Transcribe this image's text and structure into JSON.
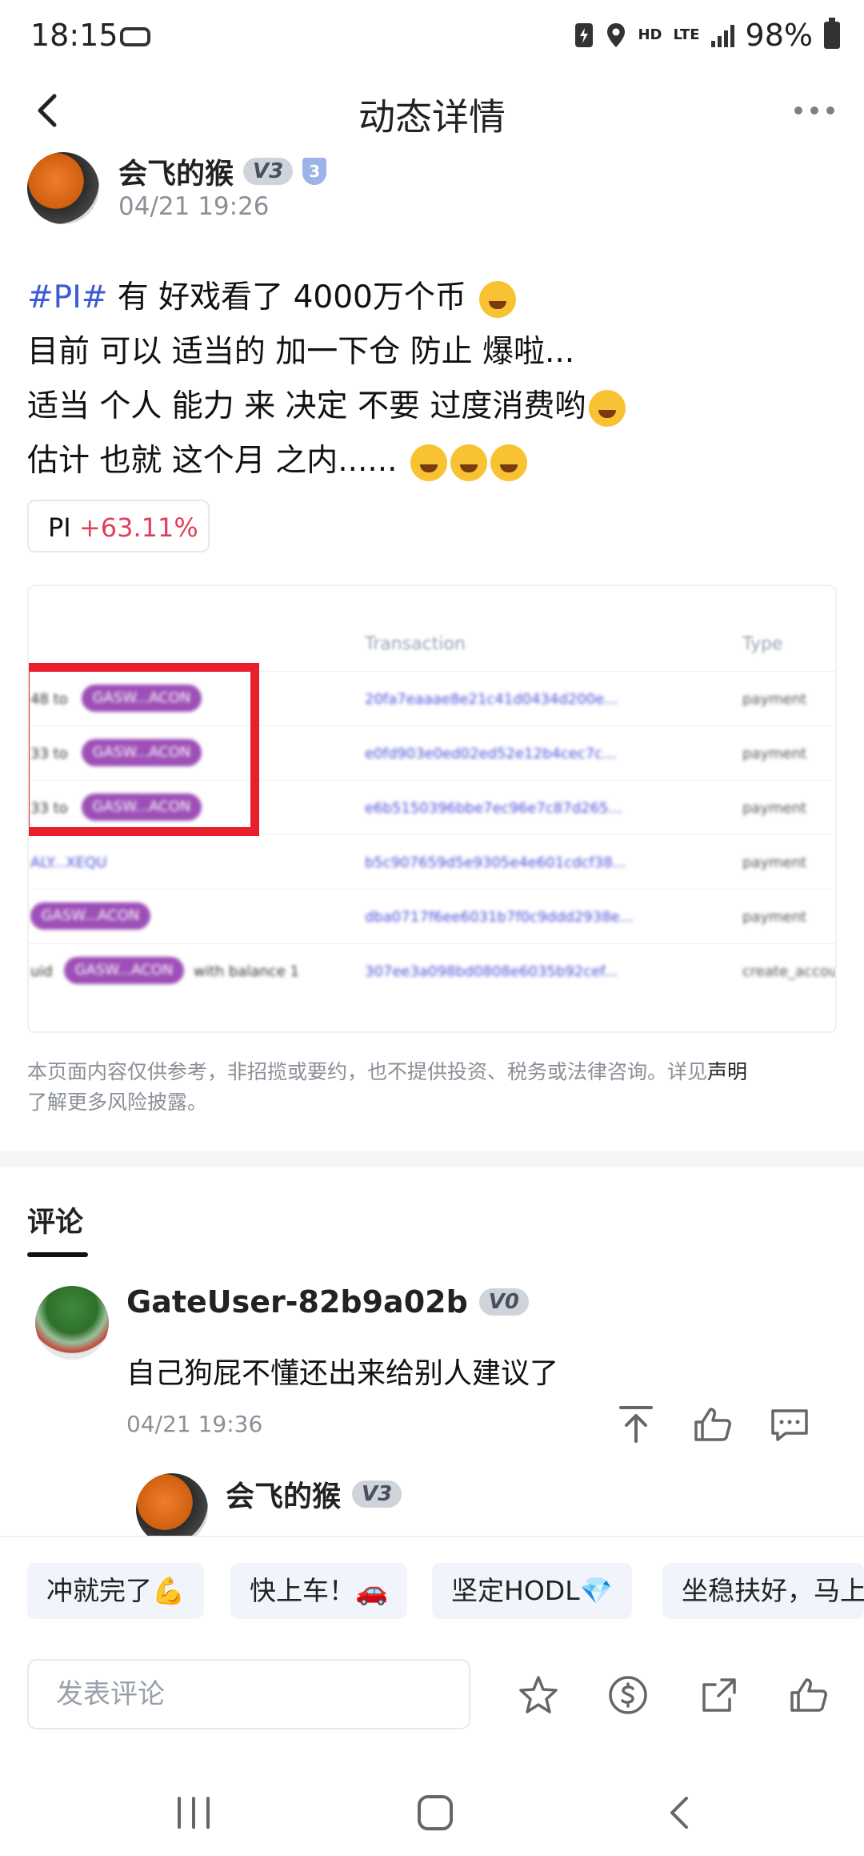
{
  "status_bar": {
    "time": "18:15",
    "hd": "HD",
    "lte": "LTE",
    "battery": "98%"
  },
  "header": {
    "title": "动态详情"
  },
  "post": {
    "author": "会飞的猴",
    "author_badge": "V3",
    "author_level": "3",
    "time": "04/21 19:26",
    "line1_tag": "#PI#",
    "line1_text": " 有 好戏看了  4000万个币",
    "line2": "目前 可以 适当的 加一下仓 防止 爆啦...",
    "line3": "适当 个人 能力 来 决定 不要 过度消费哟",
    "line4": "估计 也就 这个月 之内......",
    "coin_chip": {
      "symbol": "PI",
      "change": "+63.11%"
    },
    "image": {
      "headers": {
        "transaction": "Transaction",
        "type": "Type"
      },
      "rows": [
        {
          "pre": "48 to",
          "pill": "GASW...ACON",
          "hash": "20fa7eaaae8e21c41d0434d200e...",
          "type": "payment"
        },
        {
          "pre": "33 to",
          "pill": "GASW...ACON",
          "hash": "e0fd903e0ed02ed52e12b4cec7c...",
          "type": "payment"
        },
        {
          "pre": "33 to",
          "pill": "GASW...ACON",
          "hash": "e6b5150396bbe7ec96e7c87d265...",
          "type": "payment"
        },
        {
          "pre": "ALY...XEQU",
          "pill": "",
          "hash": "b5c907659d5e9305e4e601cdcf38...",
          "type": "payment"
        },
        {
          "pre": "",
          "pill": "GASW...ACON",
          "hash": "dba0717f6ee6031b7f0c9ddd2938e...",
          "type": "payment"
        },
        {
          "pre": "uid",
          "pill": "GASW...ACON",
          "hash": "307ee3a098bd0808e6035b92cef...",
          "type": "create_account"
        }
      ],
      "row_suffix_last": "with balance 1"
    },
    "disclaimer_text": "本页面内容仅供参考，非招揽或要约，也不提供投资、税务或法律咨询。详见",
    "disclaimer_link": "声明",
    "disclaimer_tail": "了解更多风险披露。"
  },
  "comments": {
    "tab_label": "评论",
    "items": [
      {
        "user": "GateUser-82b9a02b",
        "badge": "V0",
        "text": "自己狗屁不懂还出来给别人建议了",
        "time": "04/21 19:36",
        "reply": {
          "user": "会飞的猴",
          "badge": "V3"
        }
      }
    ]
  },
  "quick_replies": [
    "冲就完了💪",
    "快上车！🚗",
    "坚定HODL💎",
    "坐稳扶好，马上"
  ],
  "comment_input": {
    "placeholder": "发表评论"
  },
  "colors": {
    "tag_blue": "#3a5bd4",
    "up_red": "#e0405a",
    "accent_purple": "#9d4fb7"
  }
}
